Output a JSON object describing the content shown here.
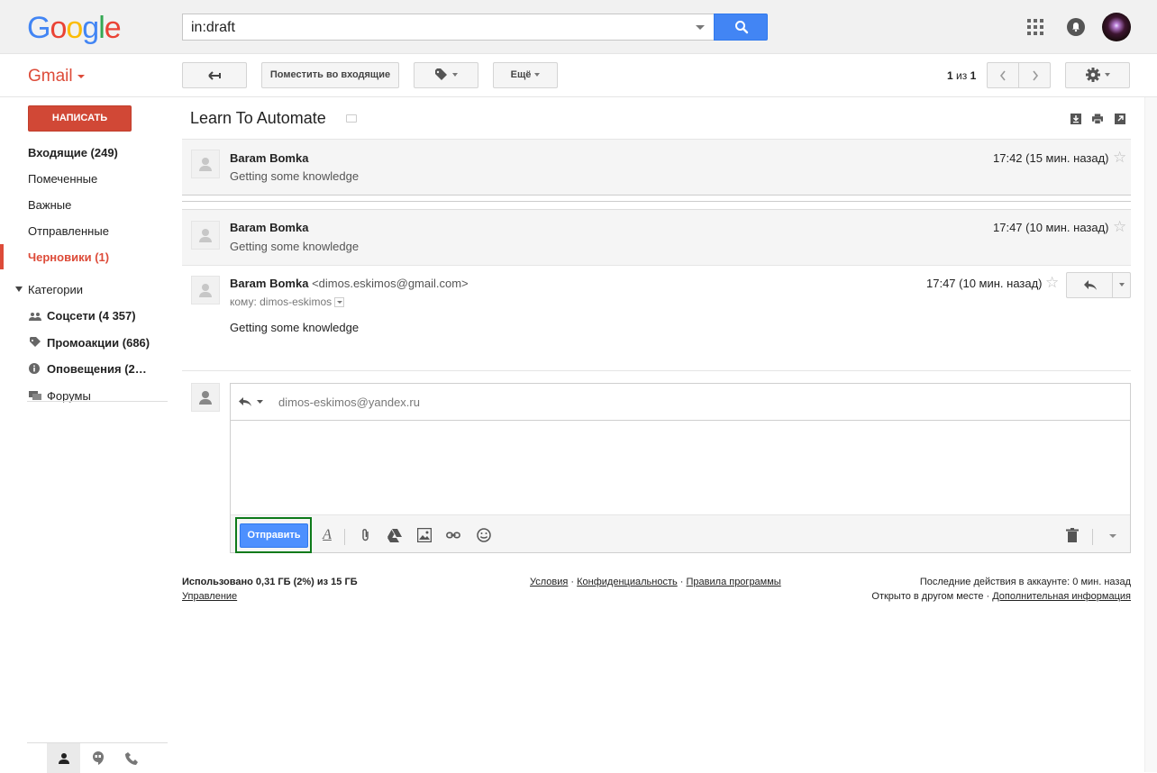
{
  "logo": {
    "letters": [
      "G",
      "o",
      "o",
      "g",
      "l",
      "e"
    ],
    "colors": [
      "#4285f4",
      "#ea4335",
      "#fbbc05",
      "#4285f4",
      "#34a853",
      "#ea4335"
    ]
  },
  "search": {
    "value": "in:draft"
  },
  "toolbar": {
    "app_label": "Gmail",
    "move_to_inbox_label": "Поместить во входящие",
    "more_label": "Ещё",
    "pager_current": "1",
    "pager_sep": " из ",
    "pager_total": "1"
  },
  "sidebar": {
    "compose_label": "НАПИСАТЬ",
    "items": [
      {
        "label": "Входящие (249)"
      },
      {
        "label": "Помеченные"
      },
      {
        "label": "Важные"
      },
      {
        "label": "Отправленные"
      },
      {
        "label": "Черновики (1)"
      }
    ],
    "categories_label": "Категории",
    "categories": [
      {
        "label": "Соцсети (4 357)"
      },
      {
        "label": "Промоакции (686)"
      },
      {
        "label": "Оповещения (2…"
      },
      {
        "label": "Форумы"
      }
    ]
  },
  "thread": {
    "subject": "Learn To Automate",
    "messages": [
      {
        "sender": "Baram Bomka",
        "snippet": "Getting some knowledge",
        "time": "17:42 (15 мин. назад)"
      },
      {
        "sender": "Baram Bomka",
        "snippet": "Getting some knowledge",
        "time": "17:47 (10 мин. назад)"
      },
      {
        "sender": "Baram Bomka",
        "email": "<dimos.eskimos@gmail.com>",
        "to_label": "кому: dimos-eskimos",
        "body": "Getting some knowledge",
        "time": "17:47 (10 мин. назад)"
      }
    ]
  },
  "reply": {
    "to": "dimos-eskimos@yandex.ru",
    "send_label": "Отправить"
  },
  "footer": {
    "storage": "Использовано 0,31 ГБ (2%) из 15 ГБ",
    "manage": "Управление",
    "terms": "Условия",
    "privacy": "Конфиденциальность",
    "policies": "Правила программы",
    "last_activity": "Последние действия в аккаунте: 0 мин. назад",
    "open_elsewhere": "Открыто в другом месте · ",
    "details": "Дополнительная информация"
  }
}
